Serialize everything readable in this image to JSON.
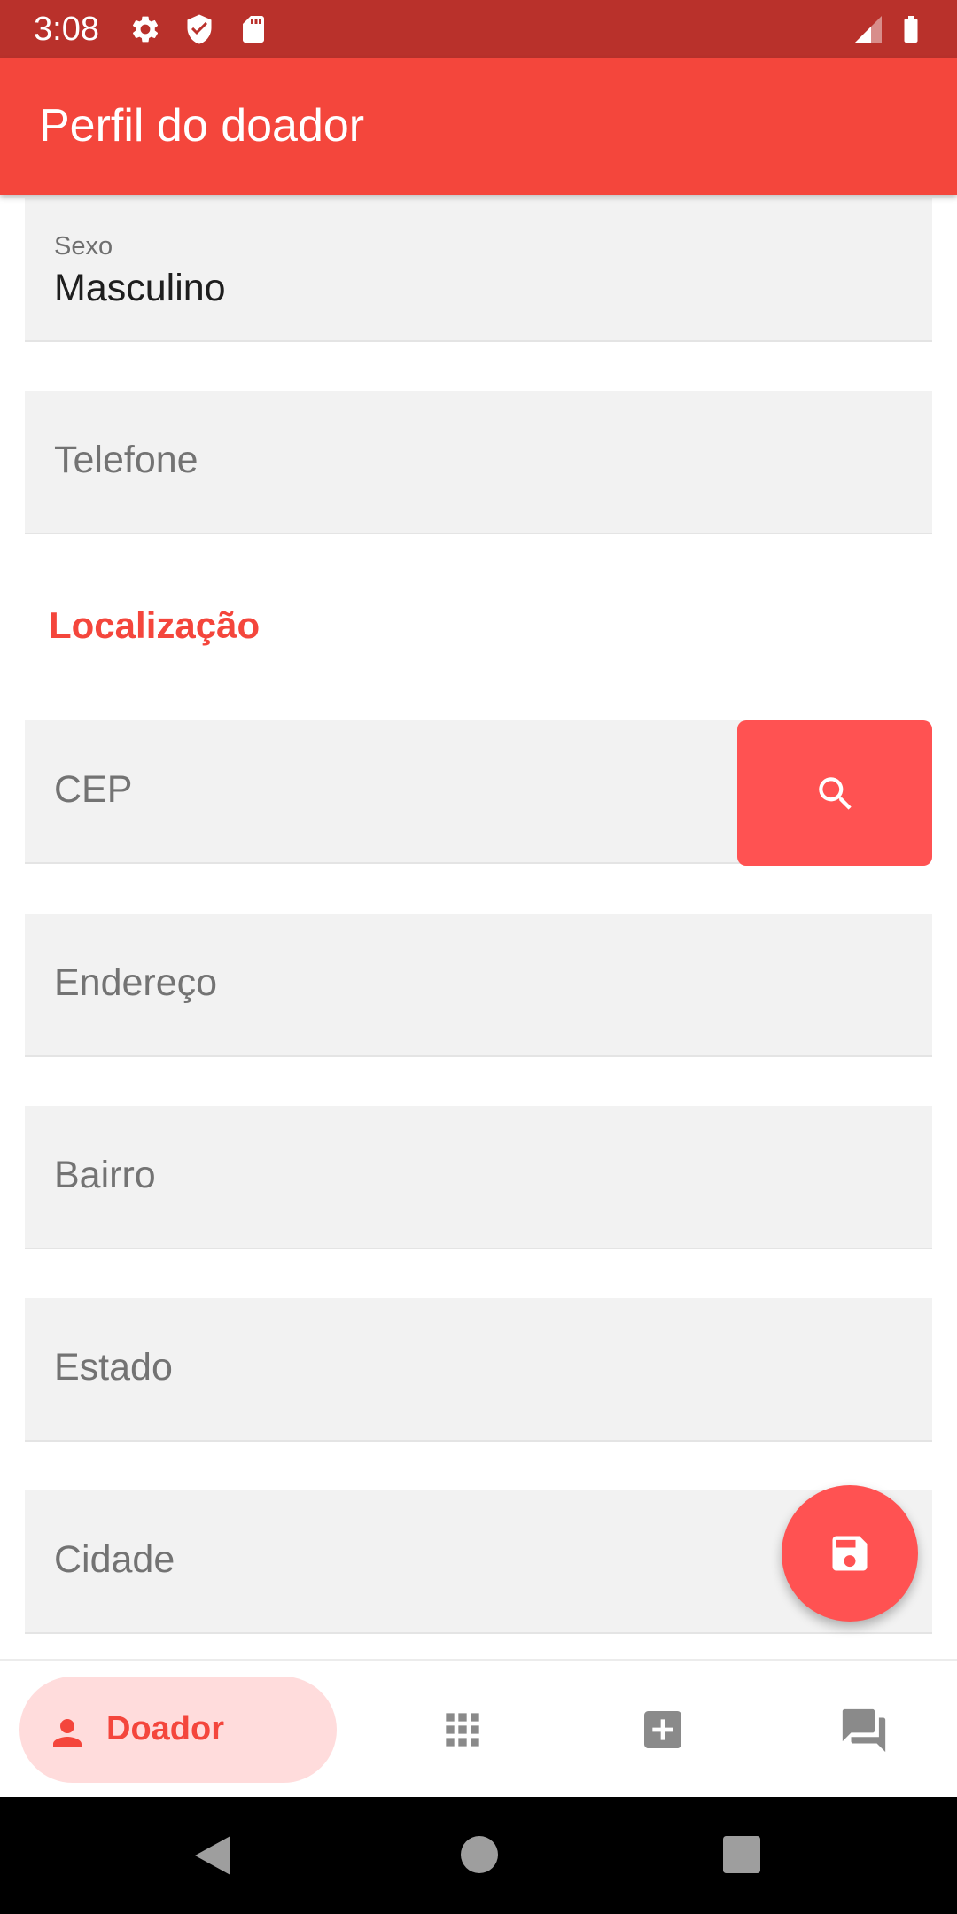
{
  "status_bar": {
    "time": "3:08",
    "icons": [
      "gear-icon",
      "shield-icon",
      "sd-card-icon",
      "signal-icon",
      "battery-icon"
    ]
  },
  "app_bar": {
    "title": "Perfil do doador"
  },
  "form": {
    "sexo": {
      "label": "Sexo",
      "value": "Masculino"
    },
    "telefone": {
      "placeholder": "Telefone"
    },
    "location_section_title": "Localização",
    "cep": {
      "placeholder": "CEP"
    },
    "endereco": {
      "placeholder": "Endereço"
    },
    "bairro": {
      "placeholder": "Bairro"
    },
    "estado": {
      "placeholder": "Estado"
    },
    "cidade": {
      "placeholder": "Cidade"
    }
  },
  "buttons": {
    "search_icon": "search-icon",
    "save_icon": "save-icon"
  },
  "bottom_nav": {
    "items": [
      {
        "label": "Doador",
        "icon": "person-icon",
        "selected": true
      },
      {
        "label": "",
        "icon": "grid-icon",
        "selected": false
      },
      {
        "label": "",
        "icon": "medical-plus-icon",
        "selected": false
      },
      {
        "label": "",
        "icon": "forum-icon",
        "selected": false
      }
    ]
  },
  "colors": {
    "status_bar": "#b9312b",
    "primary": "#f4463c",
    "accent": "#ff5252",
    "field_background": "#f2f2f2",
    "nav_selected_background": "#ffdcdc",
    "nav_inactive": "#8a8a8a"
  }
}
